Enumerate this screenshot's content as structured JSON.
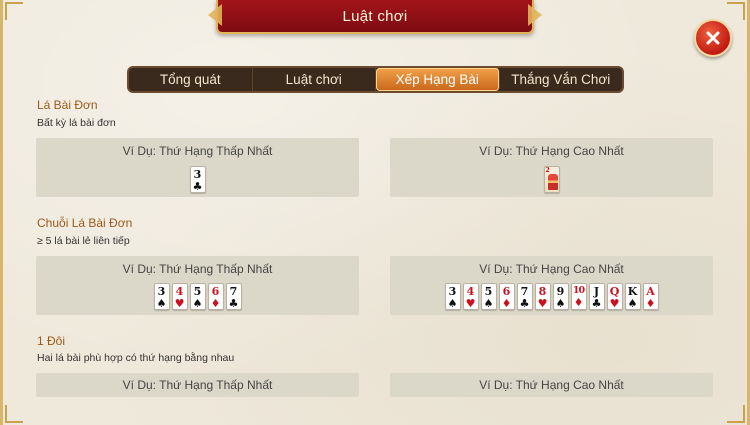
{
  "header": {
    "title": "Luật chơi"
  },
  "close": {
    "icon": "close-icon"
  },
  "tabs": [
    {
      "label": "Tổng quát",
      "active": false
    },
    {
      "label": "Luật chơi",
      "active": false
    },
    {
      "label": "Xếp Hạng Bài",
      "active": true
    },
    {
      "label": "Thắng Vắn Chơi",
      "active": false
    }
  ],
  "sections": [
    {
      "title": "Lá Bài Đơn",
      "desc": "Bất kỳ lá bài đơn",
      "low_label": "Ví Dụ: Thứ Hạng Thấp Nhất",
      "high_label": "Ví Dụ: Thứ Hạng Cao Nhất",
      "low_cards": [
        {
          "rank": "3",
          "suit": "♣"
        }
      ],
      "high_cards": [
        {
          "rank": "2",
          "suit": "♥"
        }
      ]
    },
    {
      "title": "Chuỗi Lá Bài Đơn",
      "desc": "≥ 5 lá bài lẻ liên tiếp",
      "low_label": "Ví Dụ: Thứ Hạng Thấp Nhất",
      "high_label": "Ví Dụ: Thứ Hạng Cao Nhất",
      "low_cards": [
        {
          "rank": "3",
          "suit": "♠"
        },
        {
          "rank": "4",
          "suit": "♥"
        },
        {
          "rank": "5",
          "suit": "♠"
        },
        {
          "rank": "6",
          "suit": "♦"
        },
        {
          "rank": "7",
          "suit": "♣"
        }
      ],
      "high_cards": [
        {
          "rank": "3",
          "suit": "♠"
        },
        {
          "rank": "4",
          "suit": "♥"
        },
        {
          "rank": "5",
          "suit": "♠"
        },
        {
          "rank": "6",
          "suit": "♦"
        },
        {
          "rank": "7",
          "suit": "♣"
        },
        {
          "rank": "8",
          "suit": "♥"
        },
        {
          "rank": "9",
          "suit": "♠"
        },
        {
          "rank": "10",
          "suit": "♦"
        },
        {
          "rank": "J",
          "suit": "♣"
        },
        {
          "rank": "Q",
          "suit": "♥"
        },
        {
          "rank": "K",
          "suit": "♠"
        },
        {
          "rank": "A",
          "suit": "♦"
        }
      ]
    },
    {
      "title": "1 Đôi",
      "desc": "Hai lá bài phù hợp có thứ hạng bằng nhau",
      "low_label": "Ví Dụ: Thứ Hạng Thấp Nhất",
      "high_label": "Ví Dụ: Thứ Hạng Cao Nhất",
      "low_cards": [],
      "high_cards": []
    }
  ],
  "colors": {
    "accent": "#f2a24a",
    "banner": "#a3141a",
    "red_suit": "#cc1020"
  }
}
